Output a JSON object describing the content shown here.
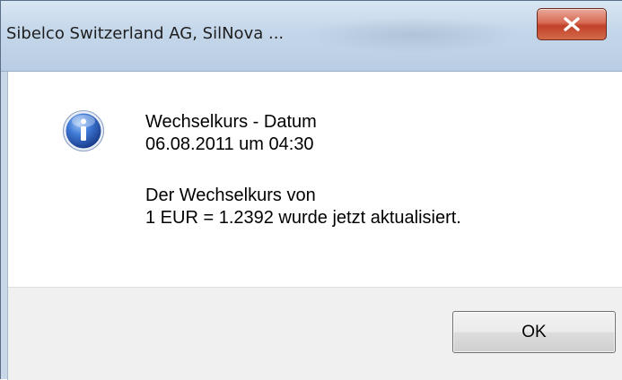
{
  "window": {
    "title": "Sibelco Switzerland AG, SilNova ..."
  },
  "titlebar": {
    "close_icon": "close-x-icon"
  },
  "message": {
    "icon": "info-icon",
    "line1": "Wechselkurs - Datum",
    "line2": "06.08.2011 um 04:30",
    "line3": "Der Wechselkurs von",
    "line4": "1 EUR = 1.2392 wurde jetzt aktualisiert."
  },
  "buttons": {
    "ok_label": "OK"
  },
  "colors": {
    "titlebar": "#c5d7ea",
    "close_button": "#c1412a",
    "footer": "#f0f0f0",
    "info_icon": "#2f67c7"
  }
}
